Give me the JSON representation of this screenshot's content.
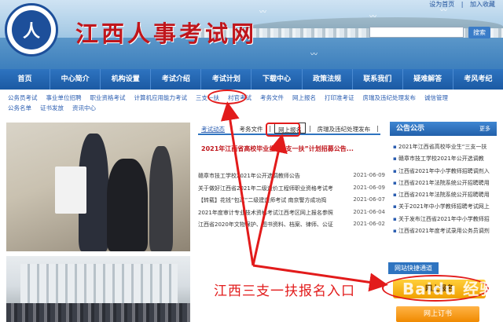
{
  "header": {
    "site_title": "江西人事考试网",
    "top_links": [
      "设为首页",
      "加入收藏"
    ],
    "search_button": "搜索",
    "search_placeholder": ""
  },
  "nav": {
    "items": [
      "首页",
      "中心简介",
      "机构设置",
      "考试介绍",
      "考试计划",
      "下载中心",
      "政策法规",
      "联系我们",
      "疑难解答",
      "考风考纪"
    ]
  },
  "subnav": {
    "items": [
      "公务员考试",
      "事业单位招聘",
      "职业资格考试",
      "计算机应用能力考试",
      "三支一扶",
      "村官考试",
      "考务文件",
      "网上报名",
      "打印准考证",
      "房瑞及违纪处理发布",
      "诚信管理",
      "公务名单",
      "证书发放",
      "资讯中心"
    ]
  },
  "tabs": [
    "考试动态",
    "考务文件",
    "网上报名",
    "房瑞及违纪处理发布"
  ],
  "featured": "2021年江西省高校毕业生“三支一扶”计划招募公告...",
  "news": [
    {
      "title": "赣章市技工学校2021年公开选调教师公告",
      "date": "2021-06-09"
    },
    {
      "title": "关于做好江西省2021年二级造价工程师职业资格考试考",
      "date": "2021-06-09"
    },
    {
      "title": "【转载】花钱“包过”二级建造师考试 南京警方成功捣",
      "date": "2021-06-07"
    },
    {
      "title": "2021年度审计专业技术资格考试江西考区网上报名参照",
      "date": "2021-06-04"
    },
    {
      "title": "江西省2020年文物保护、图书资料、档案、律师、公证",
      "date": "2021-06-02"
    }
  ],
  "announcements": {
    "title": "公告公示",
    "more": "更多",
    "items": [
      "2021年江西省高校毕业生“三支一扶",
      "赣章市技工学校2021年公开选调教",
      "江西省2021年中小学教师招聘调剂入",
      "江西省2021年法院系统公开招聘聘用",
      "江西省2021年法院系统公开招聘聘用",
      "关于2021年中小学教师招聘考试网上",
      "关于发布江西省2021年中小学教师招",
      "江西省2021年度考试录用公务员调剂"
    ]
  },
  "quick_access": {
    "title": "网站快捷通道",
    "register_button": "网上报名",
    "order_button": "网上订书"
  },
  "annotation": {
    "text": "江西三支一扶报名入口"
  },
  "watermark": {
    "text": "Baidu 经验"
  },
  "colors": {
    "nav_blue": "#2e74c0",
    "title_red": "#c0161c",
    "annotation_red": "#e21b1b",
    "button_orange": "#f0a000"
  }
}
